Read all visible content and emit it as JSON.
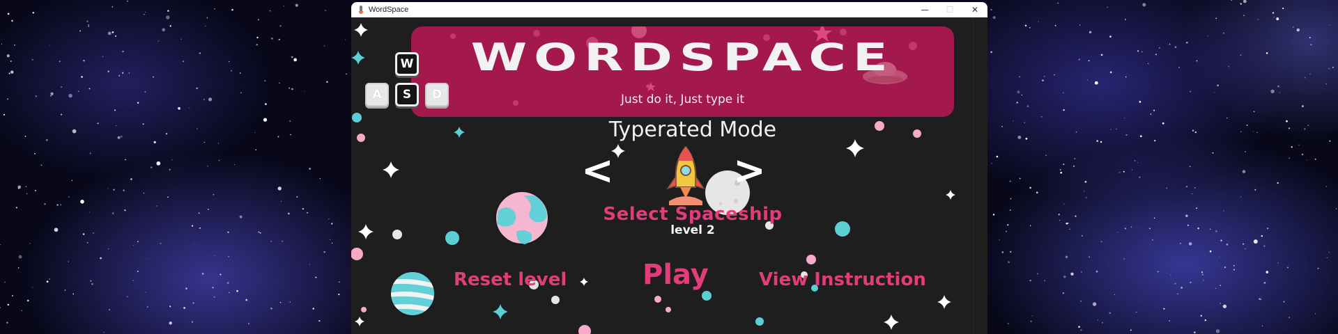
{
  "window": {
    "title": "WordSpace",
    "controls": {
      "minimize": "—",
      "maximize": "☐",
      "close": "✕"
    }
  },
  "banner": {
    "title": "WORDSPACE",
    "tagline": "Just do it, Just type it",
    "color": "#a3184d"
  },
  "logo_keys": [
    "W",
    "A",
    "S",
    "D"
  ],
  "mode": {
    "title": "Typerated Mode"
  },
  "selector": {
    "prev_label": "<",
    "next_label": ">",
    "label": "Select Spaceship",
    "level": "level 2"
  },
  "menu": {
    "reset_label": "Reset level",
    "play_label": "Play",
    "instructions_label": "View Instruction"
  },
  "colors": {
    "accent_pink": "#e23c7a",
    "cyan": "#5ccfd4",
    "light_pink": "#f6a9c8",
    "background": "#1e1e1e"
  },
  "icons": [
    "rocket-icon",
    "earth-planet-icon",
    "moon-planet-icon",
    "striped-planet-icon",
    "ufo-icon"
  ]
}
